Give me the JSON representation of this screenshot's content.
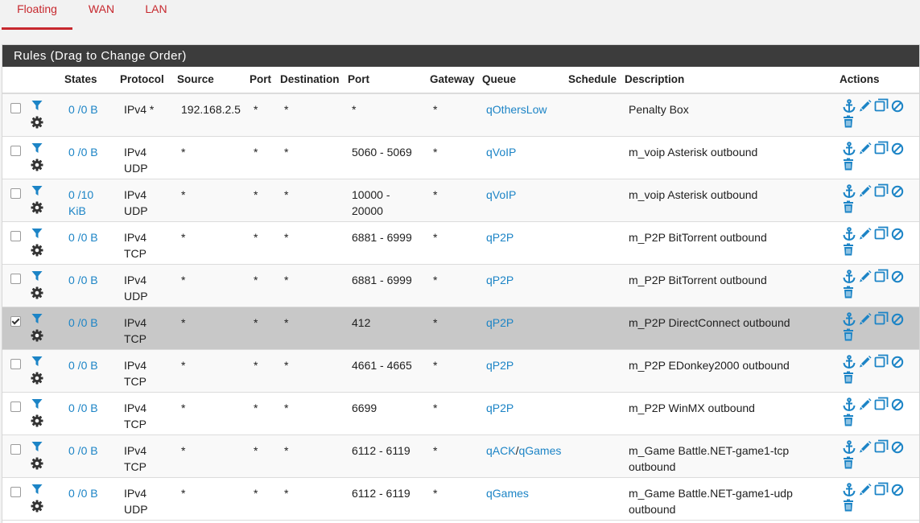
{
  "tabs": [
    {
      "label": "Floating",
      "active": true
    },
    {
      "label": "WAN",
      "active": false
    },
    {
      "label": "LAN",
      "active": false
    }
  ],
  "panel_title": "Rules (Drag to Change Order)",
  "columns": {
    "states": "States",
    "protocol": "Protocol",
    "source": "Source",
    "sport": "Port",
    "destination": "Destination",
    "dport": "Port",
    "gateway": "Gateway",
    "queue": "Queue",
    "schedule": "Schedule",
    "description": "Description",
    "actions": "Actions"
  },
  "icons": {
    "filter": "filter-icon",
    "advanced": "gear-icon",
    "anchor": "anchor-icon",
    "edit": "pencil-icon",
    "copy": "copy-icon",
    "disable": "disable-icon",
    "delete": "trash-icon"
  },
  "colors": {
    "accent": "#c7282e",
    "link": "#1c84c6",
    "heading": "#3c3c3c",
    "selected_row": "#c8c8c8"
  },
  "rules": [
    {
      "checked": false,
      "states_line1": "0 /0 B",
      "states_line2": "",
      "proto_line1": "IPv4 *",
      "proto_line2": "",
      "source": "192.168.2.5",
      "sport": "*",
      "destination": "*",
      "dport_line1": "*",
      "dport_line2": "",
      "gateway": "*",
      "queue1": "qOthersLow",
      "queue_sep": "",
      "queue2": "",
      "schedule": "",
      "desc_line1": "Penalty Box",
      "desc_line2": ""
    },
    {
      "checked": false,
      "states_line1": "0 /0 B",
      "states_line2": "",
      "proto_line1": "IPv4",
      "proto_line2": "UDP",
      "source": "*",
      "sport": "*",
      "destination": "*",
      "dport_line1": "5060 - 5069",
      "dport_line2": "",
      "gateway": "*",
      "queue1": "qVoIP",
      "queue_sep": "",
      "queue2": "",
      "schedule": "",
      "desc_line1": "m_voip Asterisk outbound",
      "desc_line2": ""
    },
    {
      "checked": false,
      "states_line1": "0 /10",
      "states_line2": "KiB",
      "proto_line1": "IPv4",
      "proto_line2": "UDP",
      "source": "*",
      "sport": "*",
      "destination": "*",
      "dport_line1": "10000 -",
      "dport_line2": "20000",
      "gateway": "*",
      "queue1": "qVoIP",
      "queue_sep": "",
      "queue2": "",
      "schedule": "",
      "desc_line1": "m_voip Asterisk outbound",
      "desc_line2": ""
    },
    {
      "checked": false,
      "states_line1": "0 /0 B",
      "states_line2": "",
      "proto_line1": "IPv4",
      "proto_line2": "TCP",
      "source": "*",
      "sport": "*",
      "destination": "*",
      "dport_line1": "6881 - 6999",
      "dport_line2": "",
      "gateway": "*",
      "queue1": "qP2P",
      "queue_sep": "",
      "queue2": "",
      "schedule": "",
      "desc_line1": "m_P2P BitTorrent outbound",
      "desc_line2": ""
    },
    {
      "checked": false,
      "states_line1": "0 /0 B",
      "states_line2": "",
      "proto_line1": "IPv4",
      "proto_line2": "UDP",
      "source": "*",
      "sport": "*",
      "destination": "*",
      "dport_line1": "6881 - 6999",
      "dport_line2": "",
      "gateway": "*",
      "queue1": "qP2P",
      "queue_sep": "",
      "queue2": "",
      "schedule": "",
      "desc_line1": "m_P2P BitTorrent outbound",
      "desc_line2": ""
    },
    {
      "checked": true,
      "states_line1": "0 /0 B",
      "states_line2": "",
      "proto_line1": "IPv4",
      "proto_line2": "TCP",
      "source": "*",
      "sport": "*",
      "destination": "*",
      "dport_line1": "412",
      "dport_line2": "",
      "gateway": "*",
      "queue1": "qP2P",
      "queue_sep": "",
      "queue2": "",
      "schedule": "",
      "desc_line1": "m_P2P DirectConnect outbound",
      "desc_line2": ""
    },
    {
      "checked": false,
      "states_line1": "0 /0 B",
      "states_line2": "",
      "proto_line1": "IPv4",
      "proto_line2": "TCP",
      "source": "*",
      "sport": "*",
      "destination": "*",
      "dport_line1": "4661 - 4665",
      "dport_line2": "",
      "gateway": "*",
      "queue1": "qP2P",
      "queue_sep": "",
      "queue2": "",
      "schedule": "",
      "desc_line1": "m_P2P EDonkey2000 outbound",
      "desc_line2": ""
    },
    {
      "checked": false,
      "states_line1": "0 /0 B",
      "states_line2": "",
      "proto_line1": "IPv4",
      "proto_line2": "TCP",
      "source": "*",
      "sport": "*",
      "destination": "*",
      "dport_line1": "6699",
      "dport_line2": "",
      "gateway": "*",
      "queue1": "qP2P",
      "queue_sep": "",
      "queue2": "",
      "schedule": "",
      "desc_line1": "m_P2P WinMX outbound",
      "desc_line2": ""
    },
    {
      "checked": false,
      "states_line1": "0 /0 B",
      "states_line2": "",
      "proto_line1": "IPv4",
      "proto_line2": "TCP",
      "source": "*",
      "sport": "*",
      "destination": "*",
      "dport_line1": "6112 - 6119",
      "dport_line2": "",
      "gateway": "*",
      "queue1": "qACK",
      "queue_sep": "/",
      "queue2": "qGames",
      "schedule": "",
      "desc_line1": "m_Game Battle.NET-game1-tcp",
      "desc_line2": "outbound"
    },
    {
      "checked": false,
      "states_line1": "0 /0 B",
      "states_line2": "",
      "proto_line1": "IPv4",
      "proto_line2": "UDP",
      "source": "*",
      "sport": "*",
      "destination": "*",
      "dport_line1": "6112 - 6119",
      "dport_line2": "",
      "gateway": "*",
      "queue1": "qGames",
      "queue_sep": "",
      "queue2": "",
      "schedule": "",
      "desc_line1": "m_Game Battle.NET-game1-udp",
      "desc_line2": "outbound"
    }
  ]
}
